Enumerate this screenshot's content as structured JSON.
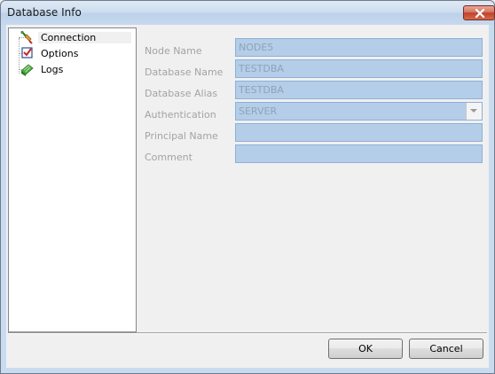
{
  "window": {
    "title": "Database Info"
  },
  "tree": {
    "items": [
      {
        "label": "Connection",
        "icon": "connection-icon",
        "selected": true
      },
      {
        "label": "Options",
        "icon": "options-checkbox-icon",
        "selected": false
      },
      {
        "label": "Logs",
        "icon": "logs-icon",
        "selected": false
      }
    ]
  },
  "form": {
    "node_name": {
      "label": "Node Name",
      "value": "NODE5"
    },
    "database_name": {
      "label": "Database Name",
      "value": "TESTDBA"
    },
    "database_alias": {
      "label": "Database Alias",
      "value": "TESTDBA"
    },
    "authentication": {
      "label": "Authentication",
      "value": "SERVER"
    },
    "principal_name": {
      "label": "Principal Name",
      "value": ""
    },
    "comment": {
      "label": "Comment",
      "value": ""
    }
  },
  "buttons": {
    "ok": "OK",
    "cancel": "Cancel"
  },
  "colors": {
    "field_bg": "#b4cde9",
    "label_disabled": "#a3a3a3"
  }
}
